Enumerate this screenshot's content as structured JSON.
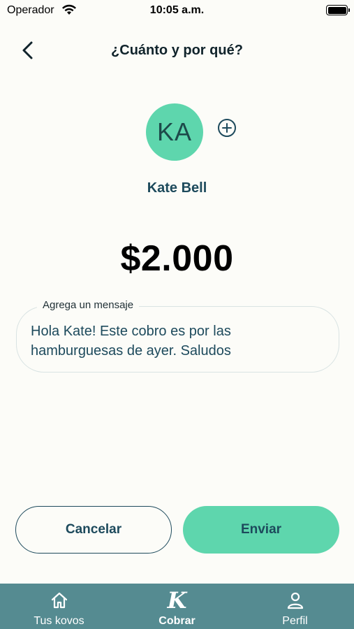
{
  "status_bar": {
    "carrier": "Operador",
    "time": "10:05 a.m.",
    "battery_level": 1.0
  },
  "header": {
    "title": "¿Cuánto y por qué?",
    "back_icon": "chevron-left-icon"
  },
  "contact": {
    "initials": "KA",
    "name": "Kate Bell",
    "avatar_color": "#5ed6ad",
    "add_icon": "plus-circle-icon"
  },
  "amount": "$2.000",
  "message": {
    "label": "Agrega un mensaje",
    "value": "Hola Kate! Este cobro es por las hamburguesas de ayer. Saludos"
  },
  "actions": {
    "cancel_label": "Cancelar",
    "send_label": "Enviar"
  },
  "tab_bar": {
    "tabs": [
      {
        "label": "Tus kovos",
        "icon": "home-icon",
        "active": false
      },
      {
        "label": "Cobrar",
        "icon": "k-logo-icon",
        "logo_text": "K",
        "active": true
      },
      {
        "label": "Perfil",
        "icon": "person-icon",
        "active": false
      }
    ]
  },
  "colors": {
    "background": "#fcfcf8",
    "accent": "#5ed6ad",
    "primary_text": "#1d4a5c",
    "tab_bar": "#558b91"
  }
}
